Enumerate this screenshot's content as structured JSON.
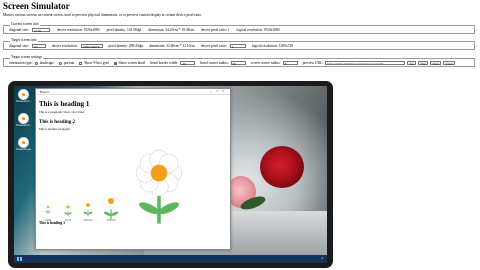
{
  "page": {
    "title": "Screen Simulator",
    "subtitle": "Mimics various screens on current screen, used to preview physical dimensions, or to preview content display at certain device pixel ratio."
  },
  "current": {
    "legend": "Current screen info",
    "diagonal_label": "diagonal size:",
    "diagonal_value": "15.56",
    "resolution": "device resolution: 1920x1080",
    "density": "pixel density: 141.58dpi",
    "dimension": "dimension: 34.45cm * 19.38cm",
    "ratio": "device pixel ratio: 1",
    "logical": "logical resolution: 1920x1080"
  },
  "target": {
    "legend": "Target screen info",
    "diagonal_label": "diagonal size:",
    "diagonal_value": "9.5",
    "resolution_label": "device resolution:",
    "resolution_value": "2560x1600",
    "density": "pixel density: 298.43dpi",
    "dimension": "dimension: 22.06cm * 12.10cm",
    "ratio_label": "device pixel ratio:",
    "ratio_value": "2",
    "logical": "logical resolution: 1280x720"
  },
  "settings": {
    "legend": "Target screen settings",
    "orientation_label": "orientation type:",
    "landscape": "landscape",
    "portrait": "portrait",
    "show_frame": "Show 9-box grid",
    "show_bezel": "Show screen bezel",
    "bezel_width_label": "bezel border width:",
    "bezel_width_value": "40",
    "bezel_radius_label": "bezel corner radius:",
    "bezel_radius_value": "30",
    "screen_radius_label": "screen corner radius:",
    "screen_radius_value": "8",
    "preview_url_label": "preview URL:",
    "preview_url_value": "https://alpha.isunshare.net/device/screensim",
    "go_button": "Go",
    "use_button": "Use",
    "save_button": "Save",
    "load_button": "Load"
  },
  "window": {
    "title": "Bosom",
    "h1": "This is heading 1",
    "p1": "This is a paragraph. Short color Value",
    "h2": "This is heading 2",
    "p2": "This is another paragraph.",
    "h3": "This is heading 3",
    "flower_labels": [
      "50x50",
      "75x75",
      "100x100",
      "150x150",
      "200x200"
    ]
  },
  "desktop": {
    "icons": [
      "Screensim.b...",
      "Screensim.b...",
      "Screensim.ap..."
    ],
    "clock": "1"
  },
  "colors": {
    "accent": "#1a73e8",
    "taskbar": "#13335a",
    "bezel": "#1b1b1b",
    "flower_center": "#f4a01a",
    "stem": "#5cb85c",
    "rose_red": "#a8101a",
    "rose_pink": "#e99aa3"
  }
}
